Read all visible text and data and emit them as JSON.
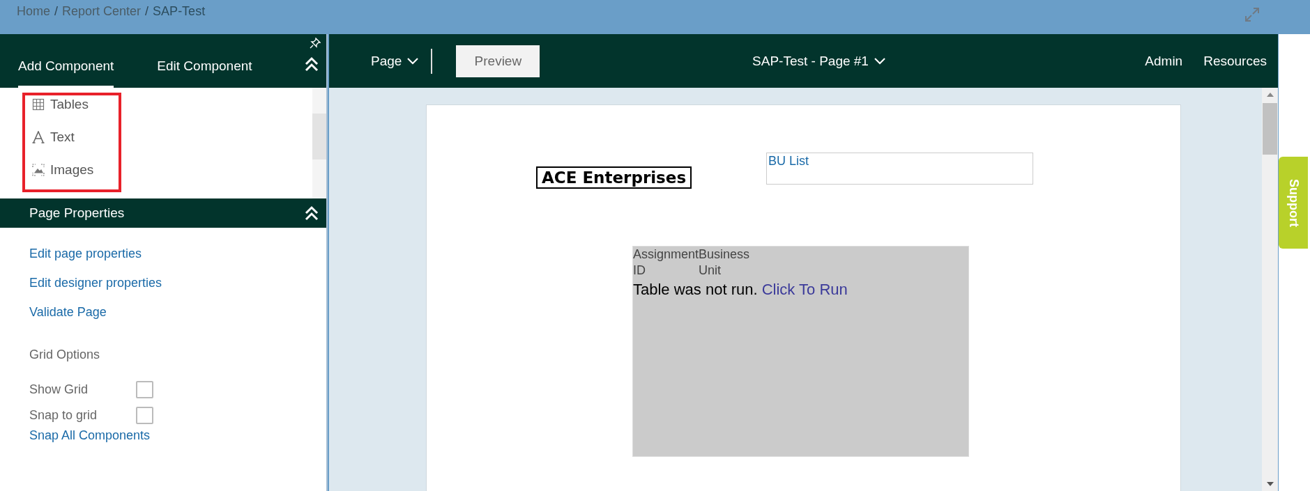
{
  "breadcrumb": [
    {
      "kind": "link",
      "label": "Home"
    },
    {
      "kind": "separator",
      "label": "/"
    },
    {
      "kind": "link",
      "label": "Report Center"
    },
    {
      "kind": "separator",
      "label": "/"
    },
    {
      "kind": "current",
      "label": "SAP-Test"
    }
  ],
  "left_panel": {
    "tabs": [
      {
        "label": "Add Component",
        "selected": true
      },
      {
        "label": "Edit Component",
        "selected": false
      }
    ],
    "components": [
      {
        "kind": "table",
        "label": "Tables"
      },
      {
        "kind": "text",
        "label": "Text"
      },
      {
        "kind": "image",
        "label": "Images"
      }
    ],
    "components_highlighted": true,
    "page_properties": {
      "title": "Page Properties",
      "links": [
        "Edit page properties",
        "Edit designer properties",
        "Validate Page"
      ],
      "grid_options": {
        "title": "Grid Options",
        "options": [
          {
            "label": "Show Grid",
            "checked": false
          },
          {
            "label": "Snap to grid",
            "checked": false
          }
        ]
      },
      "snap_link": "Snap All Components"
    }
  },
  "toolbar": {
    "page_menu": "Page",
    "preview_button": "Preview",
    "page_title": "SAP-Test - Page #1",
    "nav": [
      "Admin",
      "Resources"
    ]
  },
  "canvas": {
    "title_box": "ACE Enterprises",
    "list_box": "BU List",
    "table": {
      "columns": [
        "Assignment ID",
        "Business Unit"
      ],
      "message": "Table was not run.",
      "run_link": "Click To Run"
    }
  },
  "support_tab": "Support"
}
